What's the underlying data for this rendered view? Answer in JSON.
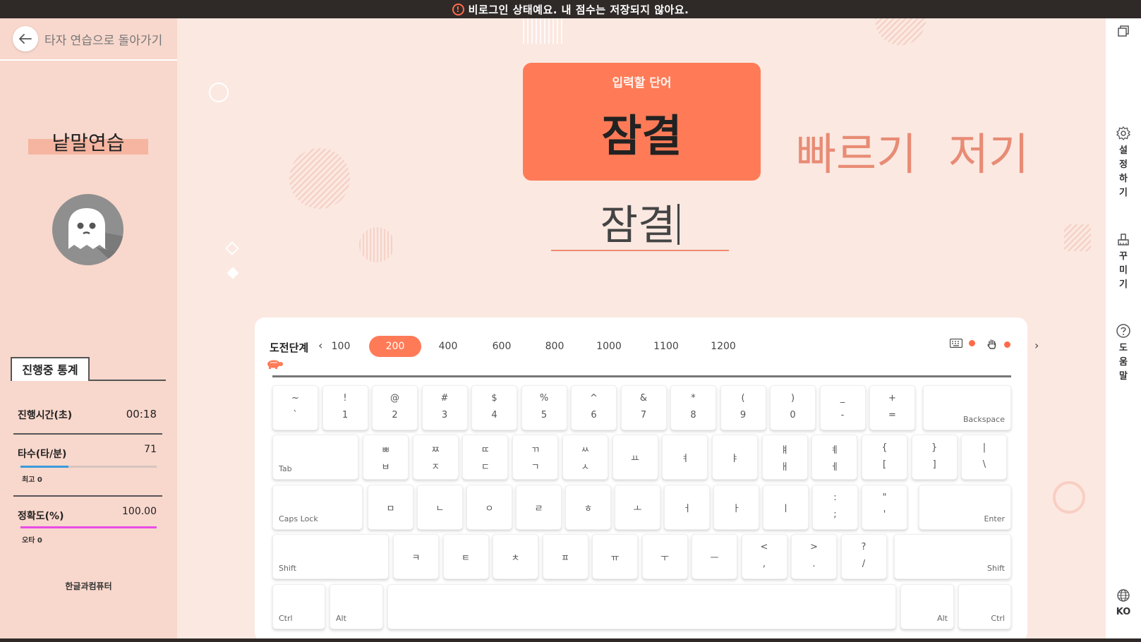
{
  "banner": {
    "text": "비로그인 상태예요. 내 점수는 저장되지 않아요.",
    "icon": "warning-icon"
  },
  "sidebar": {
    "back_label": "타자 연습으로 돌아가기",
    "mode_title": "낱말연습",
    "stats_tab": "진행중 통계",
    "elapsed_label": "진행시간(초)",
    "elapsed_value": "00:18",
    "speed_label": "타수(타/분)",
    "speed_value": "71",
    "speed_best": "최고 0",
    "speed_fraction": 0.35,
    "accuracy_label": "정확도(%)",
    "accuracy_value": "100.00",
    "accuracy_errors": "오타 0",
    "accuracy_fraction": 1.0,
    "brand": "한글과컴퓨터"
  },
  "rail": {
    "settings_label": [
      "설",
      "정",
      "하",
      "기"
    ],
    "decorate_label": [
      "꾸",
      "미",
      "기"
    ],
    "help_label": [
      "도",
      "움",
      "말"
    ],
    "language": "KO"
  },
  "center": {
    "card_caption": "입력할 단어",
    "current_word": "잠결",
    "next_words": [
      "빠르기",
      "저기"
    ],
    "typed_text": "잠결"
  },
  "keyboard": {
    "level_label": "도전단계",
    "levels": [
      "100",
      "200",
      "400",
      "600",
      "800",
      "1000",
      "1100",
      "1200"
    ],
    "active_level": "200",
    "rows": [
      [
        [
          "~",
          "`"
        ],
        [
          "!",
          "1"
        ],
        [
          "@",
          "2"
        ],
        [
          "#",
          "3"
        ],
        [
          "$",
          "4"
        ],
        [
          "%",
          "5"
        ],
        [
          "^",
          "6"
        ],
        [
          "&",
          "7"
        ],
        [
          "*",
          "8"
        ],
        [
          "(",
          "9"
        ],
        [
          ")",
          "0"
        ],
        [
          "_",
          "-"
        ],
        [
          "+",
          "="
        ]
      ],
      [
        [
          "ㅃ",
          "ㅂ"
        ],
        [
          "ㅉ",
          "ㅈ"
        ],
        [
          "ㄸ",
          "ㄷ"
        ],
        [
          "ㄲ",
          "ㄱ"
        ],
        [
          "ㅆ",
          "ㅅ"
        ],
        [
          "",
          "ㅛ"
        ],
        [
          "",
          "ㅕ"
        ],
        [
          "",
          "ㅑ"
        ],
        [
          "ㅒ",
          "ㅐ"
        ],
        [
          "ㅖ",
          "ㅔ"
        ],
        [
          "{",
          "["
        ],
        [
          "}",
          "]"
        ],
        [
          "|",
          "\\"
        ]
      ],
      [
        [
          "",
          "ㅁ"
        ],
        [
          "",
          "ㄴ"
        ],
        [
          "",
          "ㅇ"
        ],
        [
          "",
          "ㄹ"
        ],
        [
          "",
          "ㅎ"
        ],
        [
          "",
          "ㅗ"
        ],
        [
          "",
          "ㅓ"
        ],
        [
          "",
          "ㅏ"
        ],
        [
          "",
          "ㅣ"
        ],
        [
          ":",
          ";"
        ],
        [
          "\"",
          "'"
        ]
      ],
      [
        [
          "",
          "ㅋ"
        ],
        [
          "",
          "ㅌ"
        ],
        [
          "",
          "ㅊ"
        ],
        [
          "",
          "ㅍ"
        ],
        [
          "",
          "ㅠ"
        ],
        [
          "",
          "ㅜ"
        ],
        [
          "",
          "ㅡ"
        ],
        [
          "<",
          ","
        ],
        [
          ">",
          "."
        ],
        [
          "?",
          "/"
        ]
      ]
    ],
    "backspace": "Backspace",
    "tab": "Tab",
    "caps": "Caps Lock",
    "enter": "Enter",
    "shift_left": "Shift",
    "shift_right": "Shift",
    "ctrl_left": "Ctrl",
    "alt_left": "Alt",
    "alt_right": "Alt",
    "ctrl_right": "Ctrl"
  }
}
